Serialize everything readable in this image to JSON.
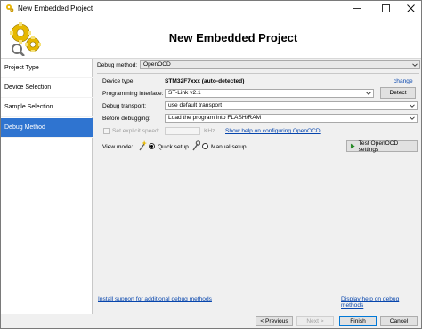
{
  "window": {
    "title": "New Embedded Project"
  },
  "header": {
    "title": "New Embedded Project"
  },
  "sidebar": {
    "items": [
      {
        "label": "Project Type"
      },
      {
        "label": "Device Selection"
      },
      {
        "label": "Sample Selection"
      },
      {
        "label": "Debug Method",
        "active": true
      }
    ]
  },
  "main": {
    "debug_method": {
      "label": "Debug method:",
      "value": "OpenOCD"
    },
    "device_type": {
      "label": "Device type:",
      "value": "STM32F7xxx (auto-detected)",
      "change_link": "change"
    },
    "programming_interface": {
      "label": "Programming interface:",
      "value": "ST-Link v2.1",
      "detect_button": "Detect"
    },
    "debug_transport": {
      "label": "Debug transport:",
      "value": "use default transport"
    },
    "before_debugging": {
      "label": "Before debugging:",
      "value": "Load the program into FLASH/RAM"
    },
    "explicit_speed": {
      "label": "Set explicit speed:",
      "unit": "KHz",
      "help_link": "Show help on configuring OpenOCD"
    },
    "view_mode": {
      "label": "View mode:",
      "quick": "Quick setup",
      "manual": "Manual setup",
      "selected": "quick"
    },
    "test_button": "Test OpenOCD settings",
    "install_link": "Install support for additional debug methods",
    "display_help_link": "Display help on debug methods"
  },
  "footer": {
    "previous": "< Previous",
    "next": "Next >",
    "finish": "Finish",
    "cancel": "Cancel"
  },
  "colors": {
    "accent": "#2f74d0",
    "link": "#0645ad"
  },
  "icons": [
    "app-gears-icon",
    "minimize-icon",
    "maximize-icon",
    "close-icon",
    "gears-logo-icon",
    "chevron-down-icon",
    "play-icon",
    "wand-icon"
  ]
}
